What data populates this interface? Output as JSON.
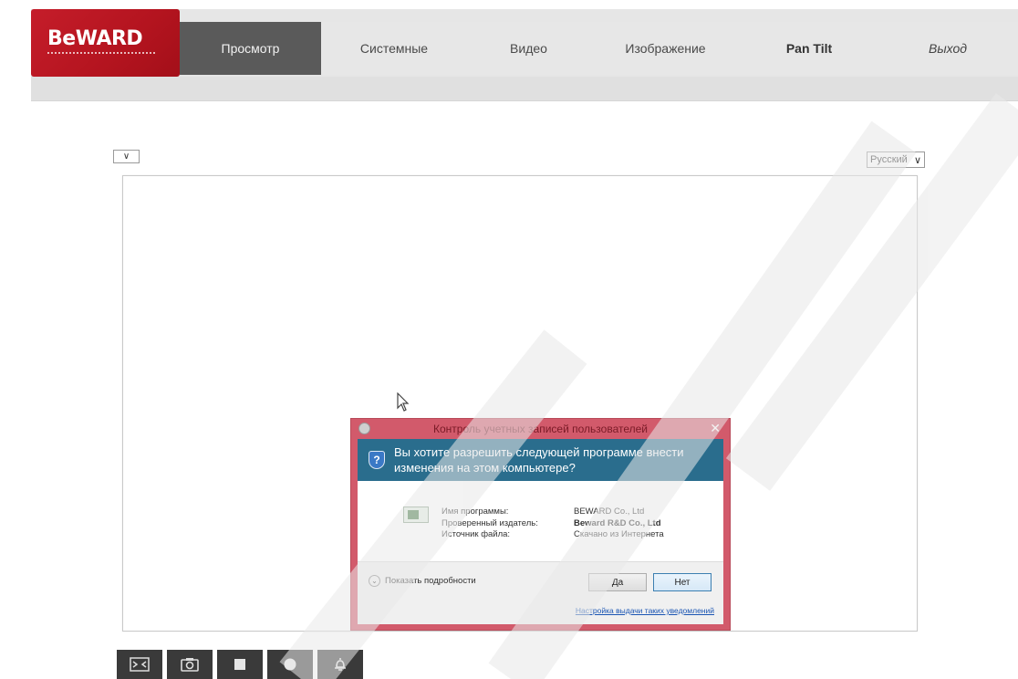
{
  "logo": {
    "text": "BeWARD"
  },
  "nav": {
    "items": [
      {
        "label": "Просмотр"
      },
      {
        "label": "Системные"
      },
      {
        "label": "Видео"
      },
      {
        "label": "Изображение"
      },
      {
        "label": "Pan Tilt"
      },
      {
        "label": "Выход"
      }
    ]
  },
  "controls": {
    "language": "Русский",
    "small_dropdown": ""
  },
  "uac": {
    "title": "Контроль учетных записей пользователей",
    "question": "Вы хотите разрешить следующей программе внести изменения на этом компьютере?",
    "rows": [
      {
        "label": "Имя программы:",
        "value": "BEWARD Co., Ltd"
      },
      {
        "label": "Проверенный издатель:",
        "value": "Beward R&D Co., Ltd"
      },
      {
        "label": "Источник файла:",
        "value": "Скачано из Интернета"
      }
    ],
    "details": "Показать подробности",
    "yes": "Да",
    "no": "Нет",
    "settings_link": "Настройка выдачи таких уведомлений"
  },
  "toolbar": {
    "buttons": [
      "fullscreen-icon",
      "snapshot-icon",
      "stop-icon",
      "record-icon",
      "alarm-icon"
    ]
  },
  "colors": {
    "accent": "#c51d2a",
    "nav_active": "#5a5a5a",
    "uac_frame": "#d25a6b",
    "uac_header": "#2a6d8d"
  }
}
